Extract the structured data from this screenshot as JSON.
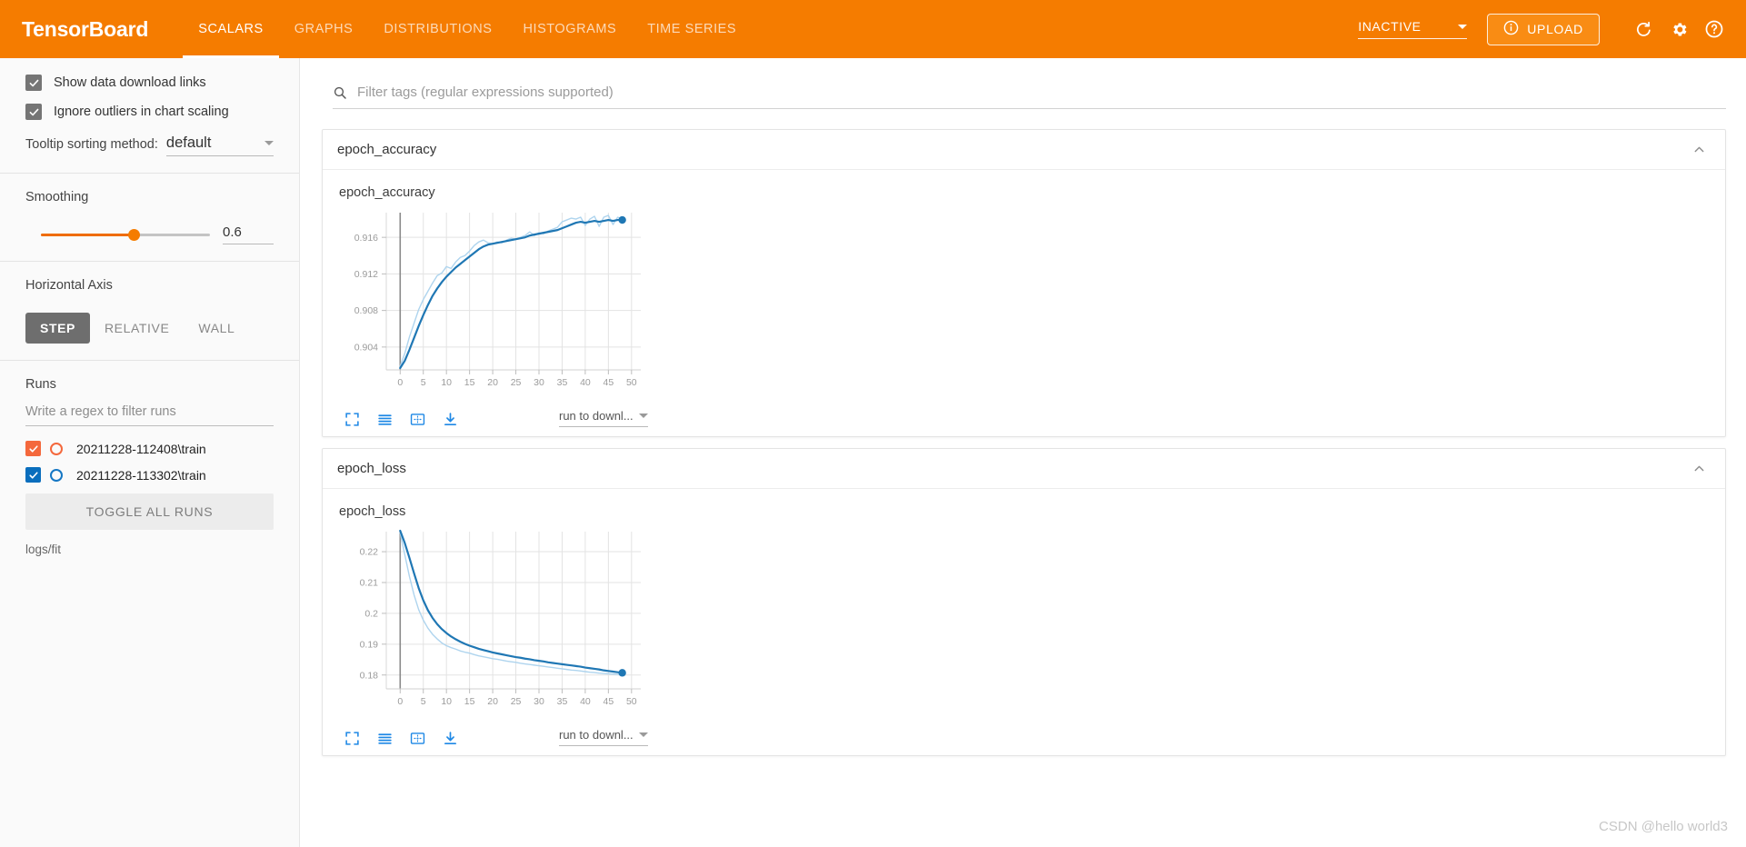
{
  "header": {
    "brand": "TensorBoard",
    "tabs": [
      {
        "label": "SCALARS",
        "active": true
      },
      {
        "label": "GRAPHS",
        "active": false
      },
      {
        "label": "DISTRIBUTIONS",
        "active": false
      },
      {
        "label": "HISTOGRAMS",
        "active": false
      },
      {
        "label": "TIME SERIES",
        "active": false
      }
    ],
    "status_value": "INACTIVE",
    "upload_label": "UPLOAD",
    "icons": [
      "info-icon",
      "refresh-icon",
      "gear-icon",
      "help-icon"
    ],
    "brand_color": "#f57c00"
  },
  "sidebar": {
    "checkboxes": [
      {
        "label": "Show data download links",
        "checked": true
      },
      {
        "label": "Ignore outliers in chart scaling",
        "checked": true
      }
    ],
    "tooltip_sorting": {
      "label": "Tooltip sorting method:",
      "value": "default"
    },
    "smoothing": {
      "title": "Smoothing",
      "value": "0.6"
    },
    "horizontal_axis": {
      "title": "Horizontal Axis",
      "options": [
        {
          "label": "STEP",
          "active": true
        },
        {
          "label": "RELATIVE",
          "active": false
        },
        {
          "label": "WALL",
          "active": false
        }
      ]
    },
    "runs": {
      "title": "Runs",
      "filter_placeholder": "Write a regex to filter runs",
      "items": [
        {
          "name": "20211228-112408\\train",
          "checked": true,
          "color": "#f4683c"
        },
        {
          "name": "20211228-113302\\train",
          "checked": true,
          "color": "#0a6ebd"
        }
      ],
      "toggle_all_label": "TOGGLE ALL RUNS",
      "logs_path": "logs/fit"
    }
  },
  "main": {
    "search_placeholder": "Filter tags (regular expressions supported)",
    "cards": [
      {
        "header": "epoch_accuracy",
        "run_to_download_label": "run to downl...",
        "toolbar_icons": [
          "fullscreen-icon",
          "data-table-icon",
          "fit-domain-icon",
          "download-icon"
        ],
        "chart_data": {
          "type": "line",
          "title": "epoch_accuracy",
          "xlabel": "",
          "ylabel": "",
          "xticks": [
            0,
            5,
            10,
            15,
            20,
            25,
            30,
            35,
            40,
            45,
            50
          ],
          "yticks": [
            0.904,
            0.908,
            0.912,
            0.916
          ],
          "xlim": [
            -3,
            52
          ],
          "ylim": [
            0.9015,
            0.9187
          ],
          "grid": true,
          "legend": false,
          "series": [
            {
              "name": "20211228-113302\\train (smoothed)",
              "color": "#1f77b4",
              "width": 2.2,
              "x": [
                0,
                1,
                2,
                3,
                4,
                5,
                6,
                7,
                8,
                9,
                10,
                11,
                12,
                13,
                14,
                15,
                16,
                17,
                18,
                19,
                20,
                21,
                22,
                23,
                24,
                25,
                26,
                27,
                28,
                29,
                30,
                31,
                32,
                33,
                34,
                35,
                36,
                37,
                38,
                39,
                40,
                41,
                42,
                43,
                44,
                45,
                46,
                47,
                48
              ],
              "y": [
                0.9017,
                0.9025,
                0.9037,
                0.905,
                0.9063,
                0.9075,
                0.9086,
                0.9096,
                0.9104,
                0.9111,
                0.9117,
                0.9122,
                0.9127,
                0.9131,
                0.9135,
                0.9139,
                0.9143,
                0.9147,
                0.915,
                0.9152,
                0.9153,
                0.9154,
                0.9155,
                0.9156,
                0.9157,
                0.9158,
                0.9159,
                0.916,
                0.9162,
                0.9163,
                0.9164,
                0.9165,
                0.9166,
                0.9167,
                0.9168,
                0.917,
                0.9172,
                0.9174,
                0.9176,
                0.9177,
                0.9176,
                0.9177,
                0.9178,
                0.9177,
                0.9178,
                0.9179,
                0.9178,
                0.9179,
                0.9179
              ]
            },
            {
              "name": "20211228-113302\\train (raw)",
              "color": "#aed4ee",
              "width": 1.4,
              "x": [
                0,
                1,
                2,
                3,
                4,
                5,
                6,
                7,
                8,
                9,
                10,
                11,
                12,
                13,
                14,
                15,
                16,
                17,
                18,
                19,
                20,
                21,
                22,
                23,
                24,
                25,
                26,
                27,
                28,
                29,
                30,
                31,
                32,
                33,
                34,
                35,
                36,
                37,
                38,
                39,
                40,
                41,
                42,
                43,
                44,
                45,
                46,
                47,
                48
              ],
              "y": [
                0.9019,
                0.9033,
                0.9051,
                0.9066,
                0.9081,
                0.9092,
                0.9101,
                0.911,
                0.9118,
                0.9121,
                0.9128,
                0.9126,
                0.9133,
                0.9138,
                0.914,
                0.9145,
                0.9151,
                0.9155,
                0.9157,
                0.9154,
                0.9153,
                0.9155,
                0.9154,
                0.9157,
                0.9159,
                0.9158,
                0.916,
                0.9162,
                0.9166,
                0.9162,
                0.9165,
                0.9164,
                0.9167,
                0.9169,
                0.9171,
                0.9177,
                0.9179,
                0.9181,
                0.918,
                0.9182,
                0.9173,
                0.918,
                0.9183,
                0.9172,
                0.9182,
                0.9184,
                0.9174,
                0.9182,
                0.918
              ]
            }
          ],
          "marker": {
            "x": 48,
            "y": 0.9179,
            "color": "#1f77b4"
          },
          "cursor_line_x": 0
        }
      },
      {
        "header": "epoch_loss",
        "run_to_download_label": "run to downl...",
        "toolbar_icons": [
          "fullscreen-icon",
          "data-table-icon",
          "fit-domain-icon",
          "download-icon"
        ],
        "chart_data": {
          "type": "line",
          "title": "epoch_loss",
          "xlabel": "",
          "ylabel": "",
          "xticks": [
            0,
            5,
            10,
            15,
            20,
            25,
            30,
            35,
            40,
            45,
            50
          ],
          "yticks": [
            0.18,
            0.19,
            0.2,
            0.21,
            0.22
          ],
          "xlim": [
            -3,
            52
          ],
          "ylim": [
            0.1755,
            0.2265
          ],
          "grid": true,
          "legend": false,
          "series": [
            {
              "name": "20211228-113302\\train (smoothed)",
              "color": "#1f77b4",
              "width": 2.2,
              "x": [
                0,
                1,
                2,
                3,
                4,
                5,
                6,
                7,
                8,
                9,
                10,
                11,
                12,
                13,
                14,
                15,
                16,
                17,
                18,
                19,
                20,
                21,
                22,
                23,
                24,
                25,
                26,
                27,
                28,
                29,
                30,
                31,
                32,
                33,
                34,
                35,
                36,
                37,
                38,
                39,
                40,
                41,
                42,
                43,
                44,
                45,
                46,
                47,
                48
              ],
              "y": [
                0.2268,
                0.2228,
                0.218,
                0.213,
                0.2082,
                0.2042,
                0.201,
                0.1985,
                0.1965,
                0.1949,
                0.1936,
                0.1925,
                0.1916,
                0.1908,
                0.1901,
                0.1895,
                0.189,
                0.1885,
                0.1881,
                0.1877,
                0.1873,
                0.187,
                0.1867,
                0.1864,
                0.1861,
                0.1858,
                0.1856,
                0.1853,
                0.1851,
                0.1848,
                0.1846,
                0.1844,
                0.1841,
                0.1839,
                0.1837,
                0.1835,
                0.1833,
                0.1831,
                0.1829,
                0.1827,
                0.1824,
                0.1822,
                0.182,
                0.1818,
                0.1815,
                0.1813,
                0.1811,
                0.1809,
                0.1807
              ]
            },
            {
              "name": "20211228-113302\\train (raw)",
              "color": "#aed4ee",
              "width": 1.4,
              "x": [
                0,
                1,
                2,
                3,
                4,
                5,
                6,
                7,
                8,
                9,
                10,
                11,
                12,
                13,
                14,
                15,
                16,
                17,
                18,
                19,
                20,
                21,
                22,
                23,
                24,
                25,
                26,
                27,
                28,
                29,
                30,
                31,
                32,
                33,
                34,
                35,
                36,
                37,
                38,
                39,
                40,
                41,
                42,
                43,
                44,
                45,
                46,
                47,
                48
              ],
              "y": [
                0.2262,
                0.219,
                0.212,
                0.206,
                0.2012,
                0.1978,
                0.1952,
                0.1932,
                0.1917,
                0.1904,
                0.1895,
                0.1889,
                0.1884,
                0.1878,
                0.1874,
                0.1871,
                0.1866,
                0.1862,
                0.1859,
                0.1856,
                0.1853,
                0.1851,
                0.1848,
                0.1845,
                0.1843,
                0.1841,
                0.1838,
                0.1836,
                0.1834,
                0.1832,
                0.183,
                0.1828,
                0.1826,
                0.1824,
                0.1822,
                0.182,
                0.1818,
                0.1816,
                0.1815,
                0.1813,
                0.1811,
                0.1809,
                0.1808,
                0.1806,
                0.1805,
                0.1804,
                0.1803,
                0.1802,
                0.1801
              ]
            }
          ],
          "marker": {
            "x": 48,
            "y": 0.1807,
            "color": "#1f77b4"
          },
          "cursor_line_x": 0
        }
      }
    ]
  },
  "watermark": "CSDN @hello world3"
}
